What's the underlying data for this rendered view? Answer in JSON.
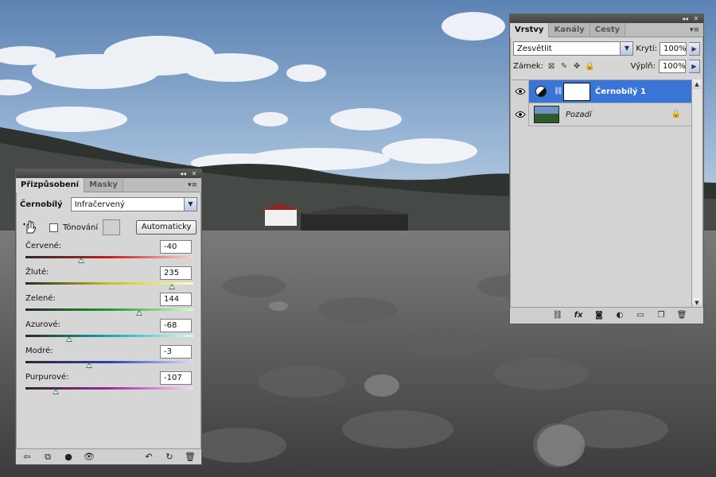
{
  "adjustments_panel": {
    "tabs": [
      {
        "label": "Přizpůsobení",
        "active": true
      },
      {
        "label": "Masky",
        "active": false
      }
    ],
    "title": "Černobílý",
    "preset_value": "Infračervený",
    "tint_label": "Tónování",
    "tint_checked": false,
    "auto_button": "Automaticky",
    "sliders": [
      {
        "label": "Červené:",
        "value": "-40",
        "track": "red",
        "fraction": 0.33
      },
      {
        "label": "Žluté:",
        "value": "235",
        "track": "yellow",
        "fraction": 0.87
      },
      {
        "label": "Zelené:",
        "value": "144",
        "track": "green",
        "fraction": 0.68
      },
      {
        "label": "Azurové:",
        "value": "-68",
        "track": "cyan",
        "fraction": 0.26
      },
      {
        "label": "Modré:",
        "value": "-3",
        "track": "blue",
        "fraction": 0.38
      },
      {
        "label": "Purpurové:",
        "value": "-107",
        "track": "magenta",
        "fraction": 0.18
      }
    ]
  },
  "layers_panel": {
    "tabs": [
      {
        "label": "Vrstvy",
        "active": true
      },
      {
        "label": "Kanály",
        "active": false
      },
      {
        "label": "Cesty",
        "active": false
      }
    ],
    "blend_mode": "Zesvětlit",
    "opacity_label": "Krytí:",
    "opacity_value": "100%",
    "lock_label": "Zámek:",
    "fill_label": "Výplň:",
    "fill_value": "100%",
    "layers": [
      {
        "name": "Černobílý 1",
        "selected": true,
        "type": "adjustment"
      },
      {
        "name": "Pozadí",
        "selected": false,
        "type": "photo",
        "locked": true
      }
    ]
  },
  "colors": {
    "selection_blue": "#3875d7",
    "panel_gray": "#d6d6d6"
  }
}
